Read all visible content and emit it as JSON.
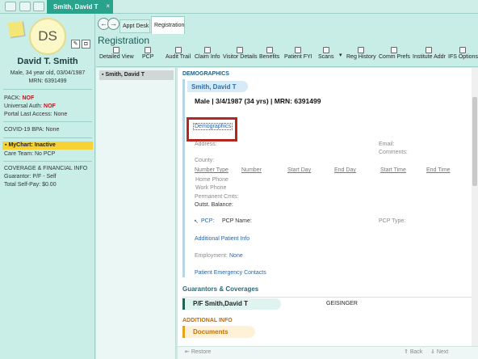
{
  "topbar": {
    "patient_tab": "Smith, David T",
    "close_glyph": "×"
  },
  "sidebar": {
    "initials": "DS",
    "name": "David T. Smith",
    "info": "Male, 34 year old, 03/04/1987",
    "mrn": "MRN: 6391499",
    "pack_label": "PACK:",
    "pack_value": "NOF",
    "universal_label": "Universal Auth:",
    "universal_value": "NOF",
    "portal": "Portal Last Access: None",
    "covid": "COVID-19 BPA: None",
    "mychart": "MyChart: Inactive",
    "care_team": "Care Team: No PCP",
    "coverage_head": "COVERAGE & FINANCIAL INFO",
    "guarantor": "Guarantor: P/F - Self",
    "self_pay": "Total Self-Pay: $0.00"
  },
  "nav": {
    "back": "←",
    "forward": "→",
    "tab_appt": "Appt Desk",
    "tab_registration": "Registration",
    "title": "Registration"
  },
  "toolbar": [
    "Detailed View",
    "PCP",
    "Audit Trail",
    "Claim Info",
    "Visitor Details",
    "Benefits",
    "Patient FYI",
    "Scans",
    "Reg History",
    "Comm Prefs",
    "Institute Addr",
    "IFS Options"
  ],
  "leftlist": {
    "item": "Smith, David T"
  },
  "main": {
    "demographics_head": "DEMOGRAPHICS",
    "card_name": "Smith, David T",
    "summary": "Male | 3/4/1987 (34 yrs) | MRN: 6391499",
    "demographics_link": "Demographics",
    "address": "Address:",
    "email": "Email:",
    "comments": "Comments:",
    "county": "County:",
    "columns": [
      "Number Type",
      "Number",
      "Start Day",
      "End Day",
      "Start Time",
      "End Time"
    ],
    "home_phone": "Home Phone",
    "work_phone": "Work Phone",
    "permanent_cmts": "Permanent Cmts:",
    "outst_balance": "Outst. Balance:",
    "pcp_label": "PCP:",
    "pcp_name": "PCP Name:",
    "pcp_type": "PCP Type:",
    "additional_patient_info": "Additional Patient Info",
    "employment_label": "Employment:",
    "employment_value": "None",
    "emergency_contacts": "Patient Emergency Contacts",
    "guarantors_head": "Guarantors & Coverages",
    "guarantor_pill": "P/F Smith,David T",
    "guarantor_payer": "GEISINGER",
    "additional_head": "ADDITIONAL INFO",
    "documents": "Documents"
  },
  "footer": {
    "restore": "Restore",
    "back": "Back",
    "next": "Next"
  },
  "colors": {
    "accent": "#2aa38d",
    "sidebar_bg": "#c9eee8",
    "highlight_box": "#b5271e",
    "mychart_yellow": "#f6d235"
  }
}
